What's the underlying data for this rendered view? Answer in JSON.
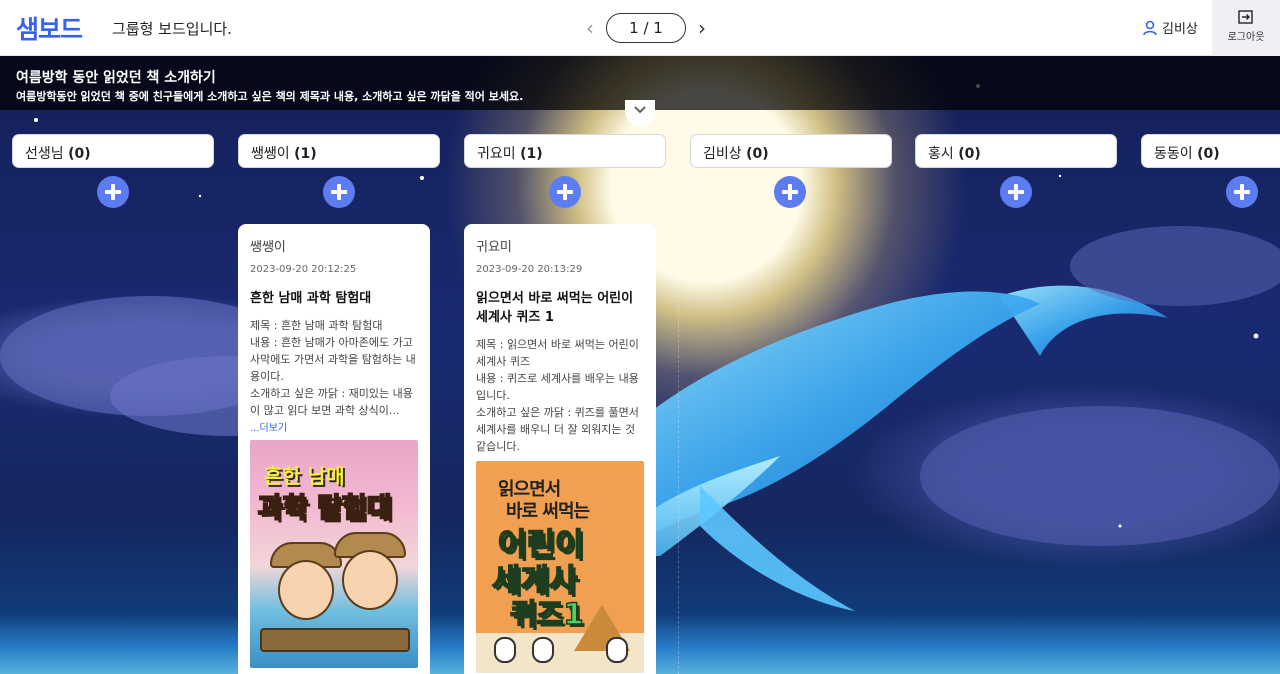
{
  "header": {
    "logo": "샘보드",
    "subtitle": "그룹형 보드입니다.",
    "page_indicator": "1 / 1",
    "user_name": "김비상",
    "logout_label": "로그아웃"
  },
  "banner": {
    "title": "여름방학 동안 읽었던 책 소개하기",
    "description": "여름방학동안 읽었던 책 중에 친구들에게 소개하고 싶은 책의 제목과 내용, 소개하고 싶은 까닭을 적어 보세요."
  },
  "columns": [
    {
      "name": "선생님",
      "count": "(0)"
    },
    {
      "name": "쌩쌩이",
      "count": "(1)"
    },
    {
      "name": "귀요미",
      "count": "(1)"
    },
    {
      "name": "김비상",
      "count": "(0)"
    },
    {
      "name": "홍시",
      "count": "(0)"
    },
    {
      "name": "동동이",
      "count": "(0)"
    }
  ],
  "cards": [
    {
      "author": "쌩쌩이",
      "time": "2023-09-20 20:12:25",
      "title": "흔한 남매 과학 탐험대",
      "body": "제목 : 흔한 남매 과학 탐험대\n내용 : 흔한 남매가 아마존에도 가고 사막에도 가면서 과학을 탐험하는 내용이다.\n소개하고 싶은 까닭 : 재미있는 내용이 많고 읽다 보면 과학 상식이...",
      "more": "...더보기",
      "cover_text_1": "흔한 남매",
      "cover_text_2": "과학 탐험대"
    },
    {
      "author": "귀요미",
      "time": "2023-09-20 20:13:29",
      "title": "읽으면서 바로 써먹는 어린이 세계사 퀴즈 1",
      "body": "제목 : 읽으면서 바로 써먹는 어린이 세계사 퀴즈\n내용 : 퀴즈로 세계사를 배우는 내용입니다.\n소개하고 싶은 까닭 : 퀴즈를 풀면서 세계사를 배우니 더 잘 외워지는 것 같습니다.",
      "cover_text_1": "읽으면서",
      "cover_text_2": "바로 써먹는",
      "cover_text_3": "어린이",
      "cover_text_4": "세계사",
      "cover_text_5": "퀴즈1"
    }
  ],
  "colors": {
    "brand": "#3563e9",
    "add_button": "#5c7cf0",
    "banner_bg": "#000000"
  },
  "icons": [
    "chevron-left-icon",
    "chevron-right-icon",
    "user-icon",
    "logout-icon",
    "chevron-down-icon",
    "plus-icon"
  ]
}
